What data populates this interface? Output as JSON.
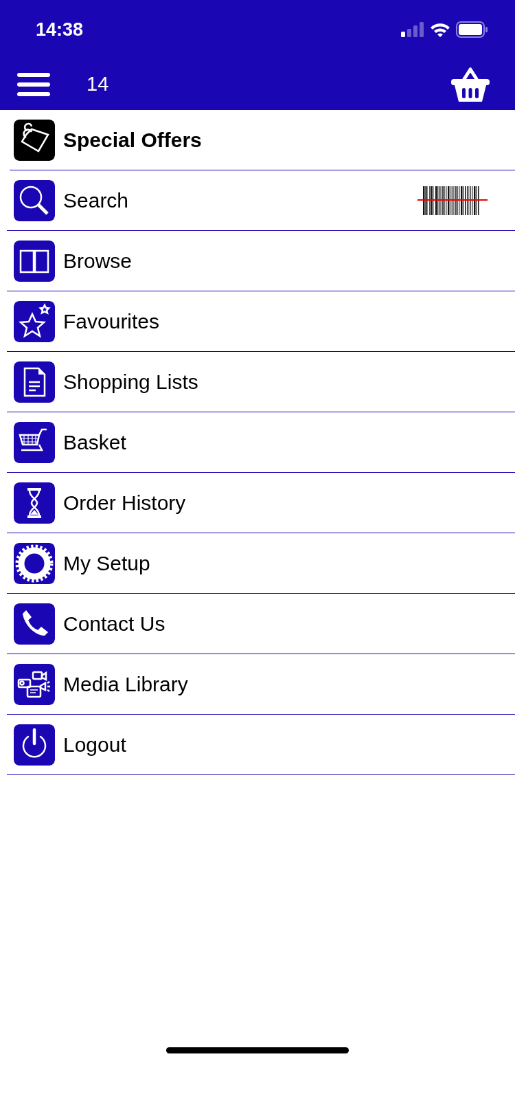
{
  "status_bar": {
    "time": "14:38"
  },
  "header": {
    "title": "14"
  },
  "menu": [
    {
      "label": "Special Offers",
      "kind": "featured"
    },
    {
      "label": "Search",
      "kind": "scan"
    },
    {
      "label": "Browse",
      "kind": "plain"
    },
    {
      "label": "Favourites",
      "kind": "plain"
    },
    {
      "label": "Shopping Lists",
      "kind": "plain"
    },
    {
      "label": "Basket",
      "kind": "plain"
    },
    {
      "label": "Order History",
      "kind": "plain"
    },
    {
      "label": "My Setup",
      "kind": "plain"
    },
    {
      "label": "Contact Us",
      "kind": "plain"
    },
    {
      "label": "Media Library",
      "kind": "plain"
    },
    {
      "label": "Logout",
      "kind": "plain"
    }
  ]
}
